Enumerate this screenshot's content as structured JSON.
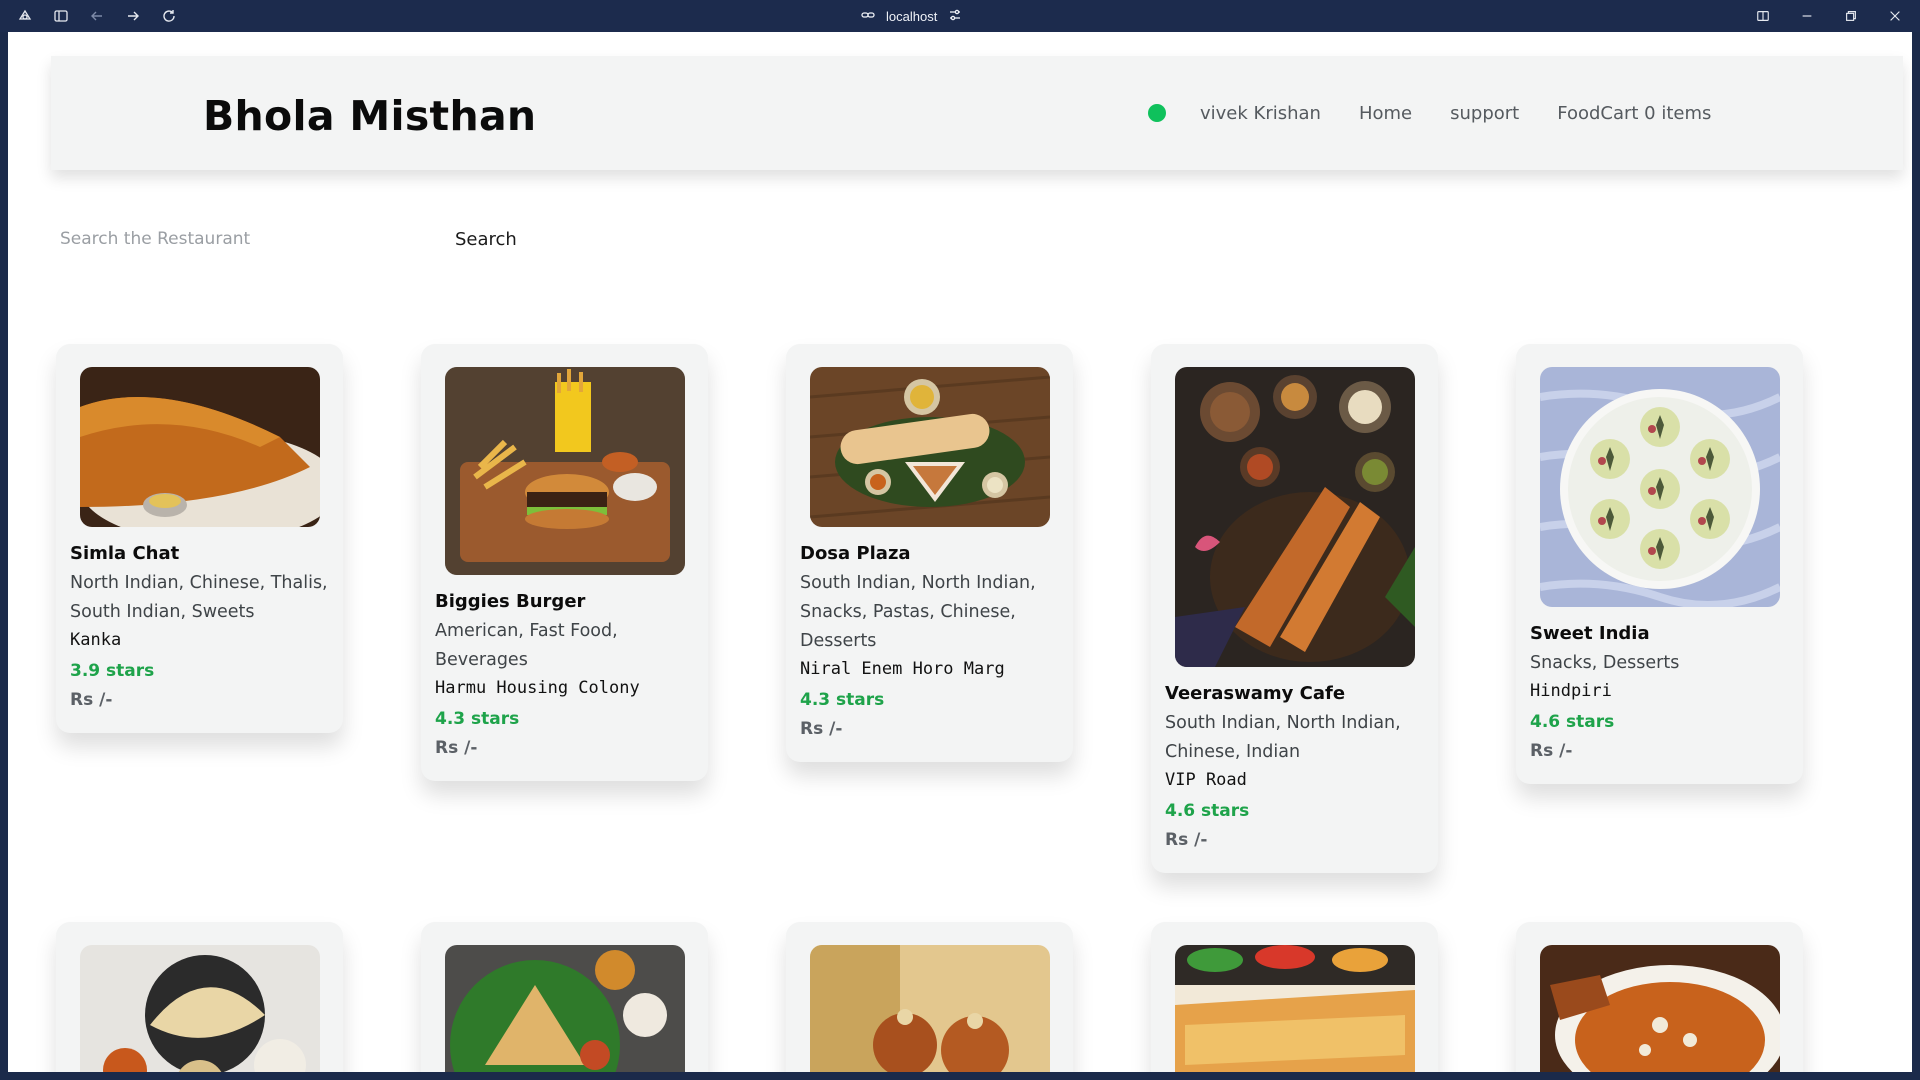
{
  "browser": {
    "url": "localhost",
    "icons": [
      "app-logo-icon",
      "sidebar-toggle-icon",
      "back-arrow-icon",
      "forward-arrow-icon",
      "reload-icon",
      "link-icon",
      "site-settings-icon",
      "split-view-icon",
      "minimize-icon",
      "restore-icon",
      "close-icon"
    ]
  },
  "header": {
    "brand": "Bhola Misthan",
    "status_color": "#0fc15c",
    "nav": {
      "user": "vivek Krishan",
      "home": "Home",
      "support": "support",
      "cart": "FoodCart 0 items"
    }
  },
  "search": {
    "placeholder": "Search the Restaurant",
    "value": "",
    "button_label": "Search"
  },
  "colors": {
    "rating": "#1ea34a",
    "card_bg": "#f3f4f4",
    "header_bg": "#f3f4f4"
  },
  "restaurants": [
    {
      "name": "Simla Chat",
      "cuisine": "North Indian, Chinese, Thalis, South Indian, Sweets",
      "area": "Kanka",
      "rating": "3.9 stars",
      "price": "Rs /-",
      "image": "dosa-plate-image"
    },
    {
      "name": "Biggies Burger",
      "cuisine": "American, Fast Food, Beverages",
      "area": "Harmu Housing Colony",
      "rating": "4.3 stars",
      "price": "Rs /-",
      "image": "burger-fries-image"
    },
    {
      "name": "Dosa Plaza",
      "cuisine": "South Indian, North Indian, Snacks, Pastas, Chinese, Desserts",
      "area": "Niral Enem Horo Marg",
      "rating": "4.3 stars",
      "price": "Rs /-",
      "image": "dosa-leaf-image"
    },
    {
      "name": "Veeraswamy Cafe",
      "cuisine": "South Indian, North Indian, Chinese, Indian",
      "area": "VIP Road",
      "rating": "4.6 stars",
      "price": "Rs /-",
      "image": "dosa-chutneys-image"
    },
    {
      "name": "Sweet India",
      "cuisine": "Snacks, Desserts",
      "area": "Hindpiri",
      "rating": "4.6 stars",
      "price": "Rs /-",
      "image": "sweets-plate-image"
    }
  ],
  "restaurants_row2_images": [
    "thali-image",
    "dosa-green-plate-image",
    "gulab-jamun-image",
    "dosa-sauces-image",
    "curry-bowl-image"
  ]
}
